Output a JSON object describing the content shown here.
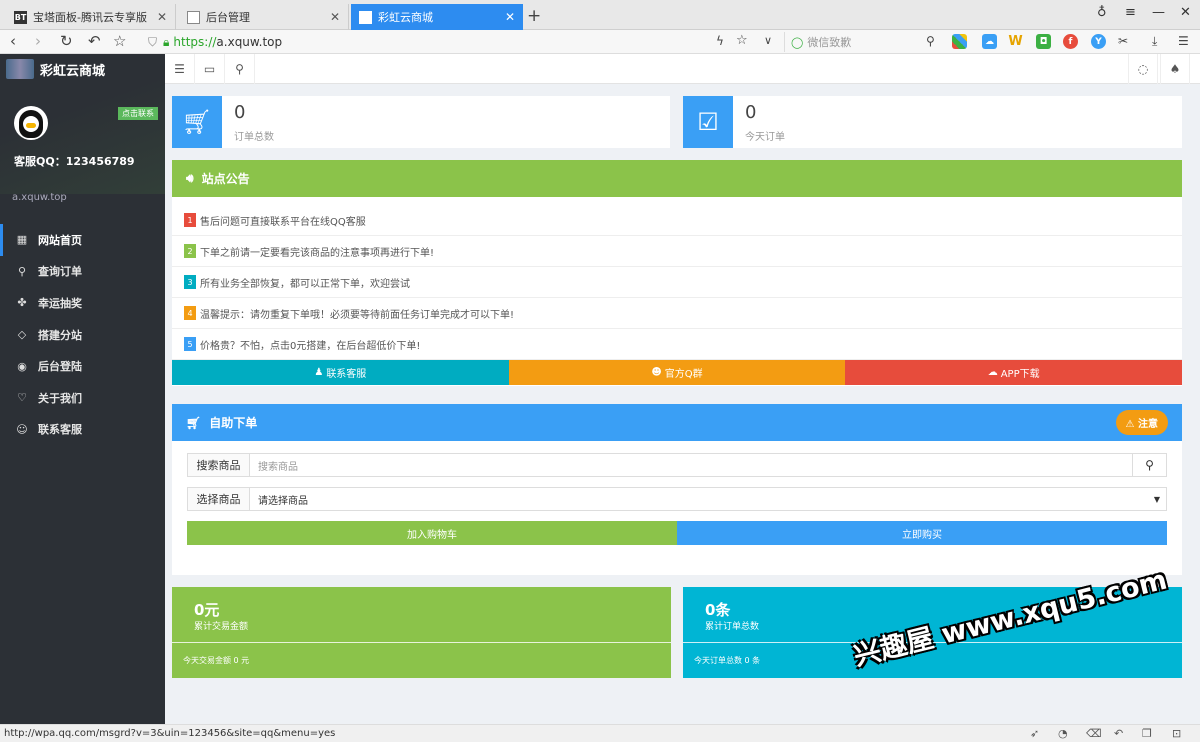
{
  "browser": {
    "tabs": [
      {
        "icon": "BT",
        "title": "宝塔面板-腾讯云专享版"
      },
      {
        "icon": "",
        "title": "后台管理"
      },
      {
        "icon": "",
        "title": "彩虹云商城"
      }
    ],
    "url_scheme": "https://",
    "url_host": "a.xquw.top",
    "search_placeholder": "微信致歉"
  },
  "sidebar": {
    "brand": "彩虹云商城",
    "contact_tag": "点击联系",
    "qq_line": "客服QQ：123456789",
    "domain": "a.xquw.top",
    "items": [
      {
        "label": "网站首页",
        "icon": "grid-icon",
        "glyph": "▦"
      },
      {
        "label": "查询订单",
        "icon": "search-icon",
        "glyph": "⚲"
      },
      {
        "label": "幸运抽奖",
        "icon": "gift-icon",
        "glyph": "✤"
      },
      {
        "label": "搭建分站",
        "icon": "diamond-icon",
        "glyph": "◇"
      },
      {
        "label": "后台登陆",
        "icon": "globe-icon",
        "glyph": "◉"
      },
      {
        "label": "关于我们",
        "icon": "heart-icon",
        "glyph": "♡"
      },
      {
        "label": "联系客服",
        "icon": "user-icon",
        "glyph": "☺"
      }
    ]
  },
  "stats": [
    {
      "value": "0",
      "label": "订单总数"
    },
    {
      "value": "0",
      "label": "今天订单"
    }
  ],
  "announce": {
    "title": "站点公告",
    "items": [
      {
        "num": "1",
        "text": "售后问题可直接联系平台在线QQ客服",
        "color": "#e74c3c"
      },
      {
        "num": "2",
        "text": "下单之前请一定要看完该商品的注意事项再进行下单!",
        "color": "#8bc34a"
      },
      {
        "num": "3",
        "text": "所有业务全部恢复，都可以正常下单，欢迎尝试",
        "color": "#00acc1"
      },
      {
        "num": "4",
        "text": "温馨提示：请勿重复下单哦！必须要等待前面任务订单完成才可以下单!",
        "color": "#f39c12"
      },
      {
        "num": "5",
        "text": "价格贵？不怕，点击0元搭建，在后台超低价下单!",
        "color": "#3a9ff5"
      }
    ],
    "buttons": [
      {
        "label": "联系客服",
        "color": "#00acc1"
      },
      {
        "label": "官方Q群",
        "color": "#f39c12"
      },
      {
        "label": "APP下载",
        "color": "#e74c3c"
      }
    ]
  },
  "order": {
    "title": "自助下单",
    "notice_btn": "注意",
    "search_label": "搜索商品",
    "search_placeholder": "搜索商品",
    "select_label": "选择商品",
    "select_value": "请选择商品",
    "add_cart": "加入购物车",
    "buy_now": "立即购买"
  },
  "cards": [
    {
      "big": "0元",
      "sub": "累计交易金额",
      "foot": "今天交易金额 0 元",
      "color": "#8bc34a"
    },
    {
      "big": "0条",
      "sub": "累计订单总数",
      "foot": "今天订单总数 0 条",
      "color": "#00b5d4"
    }
  ],
  "watermark": "兴趣屋 www.xqu5.com",
  "status_url": "http://wpa.qq.com/msgrd?v=3&uin=123456&site=qq&menu=yes",
  "colors": {
    "primary": "#3a9ff5",
    "green": "#8bc34a",
    "sidebar": "#2c3036"
  }
}
